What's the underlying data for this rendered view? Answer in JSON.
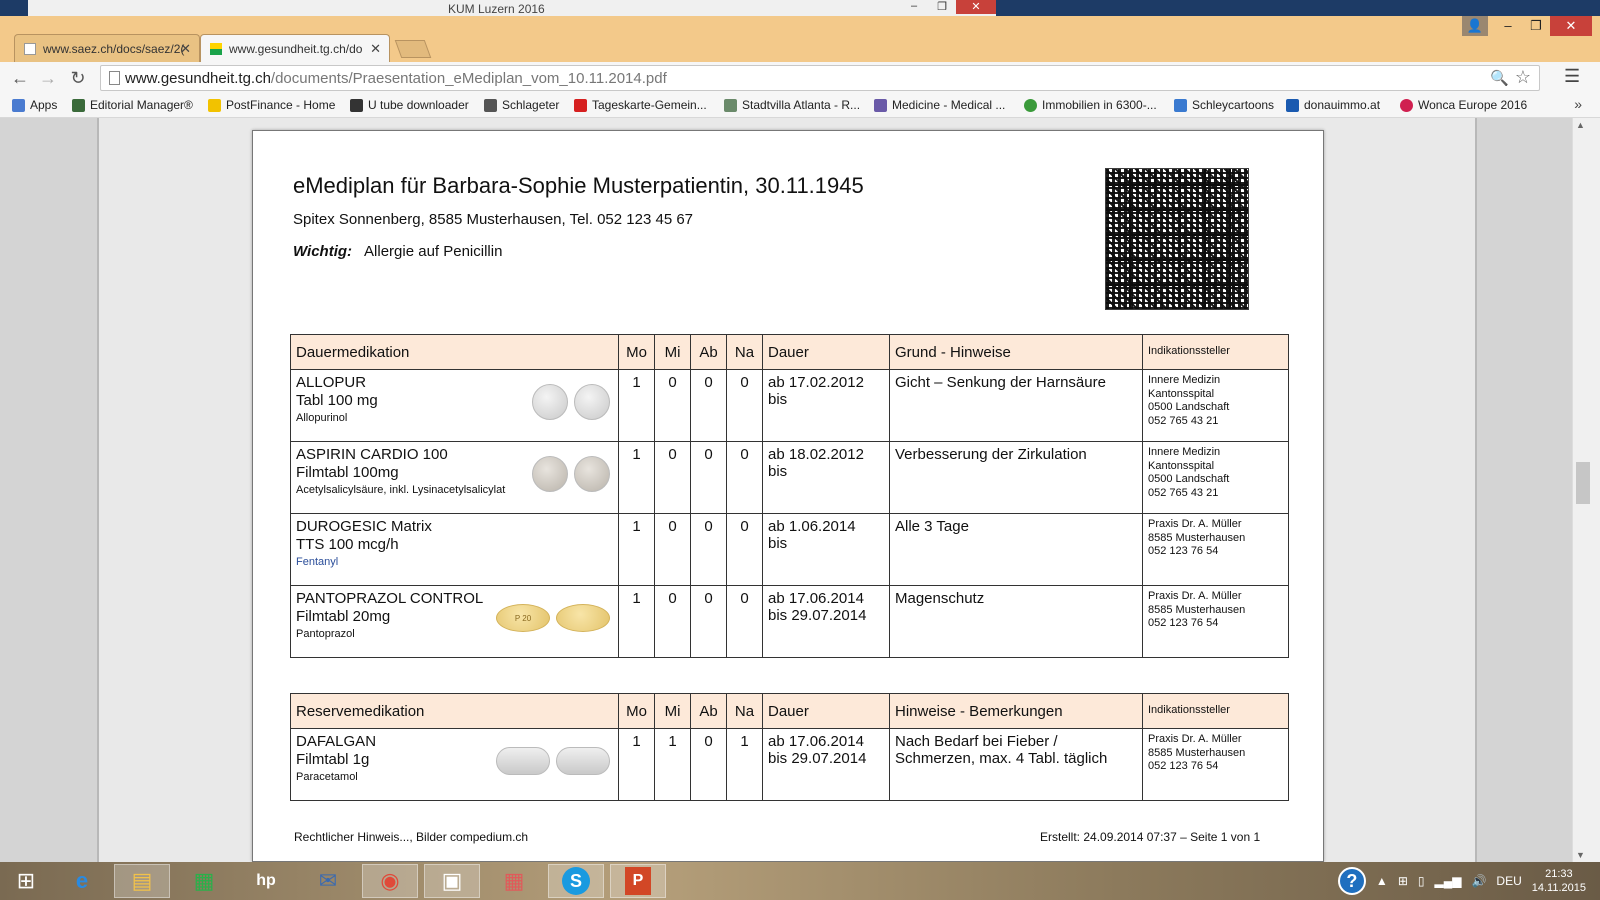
{
  "background_window": {
    "title": "KUM Luzern 2016"
  },
  "browser": {
    "tabs": [
      {
        "label": "www.saez.ch/docs/saez/2(",
        "active": false
      },
      {
        "label": "www.gesundheit.tg.ch/do",
        "active": true
      }
    ],
    "url_host": "www.gesundheit.tg.ch",
    "url_path": "/documents/Praesentation_eMediplan_vom_10.11.2014.pdf",
    "bookmarks": [
      {
        "label": "Apps",
        "icon": "apps-grid-icon",
        "color": "#4a7bd0"
      },
      {
        "label": "Editorial Manager®",
        "icon": "editorial-icon",
        "color": "#3a6a3a"
      },
      {
        "label": "PostFinance - Home",
        "icon": "postfinance-icon",
        "color": "#f2c200"
      },
      {
        "label": "U tube downloader",
        "icon": "downloader-icon",
        "color": "#333333"
      },
      {
        "label": "Schlageter",
        "icon": "schlageter-icon",
        "color": "#555555"
      },
      {
        "label": "Tageskarte-Gemein...",
        "icon": "sbb-icon",
        "color": "#d62020"
      },
      {
        "label": "Stadtvilla Atlanta - R...",
        "icon": "building-icon",
        "color": "#6a8a6a"
      },
      {
        "label": "Medicine - Medical ...",
        "icon": "medicine-icon",
        "color": "#6a5aa8"
      },
      {
        "label": "Immobilien in 6300-...",
        "icon": "check-icon",
        "color": "#3a9a3a"
      },
      {
        "label": "Schleycartoons",
        "icon": "w-icon",
        "color": "#3a7ad0"
      },
      {
        "label": "donauimmo.at",
        "icon": "d-icon",
        "color": "#1a5ab0"
      },
      {
        "label": "Wonca Europe 2016",
        "icon": "heart-icon",
        "color": "#d02050"
      }
    ],
    "bookmarks_more": "»"
  },
  "document": {
    "title": "eMediplan für Barbara-Sophie Musterpatientin, 30.11.1945",
    "subtitle": "Spitex Sonnenberg, 8585 Musterhausen, Tel. 052 123 45 67",
    "allergy_label": "Wichtig:",
    "allergy_text": "Allergie auf Penicillin",
    "dauer_table": {
      "headers": [
        "Dauermedikation",
        "Mo",
        "Mi",
        "Ab",
        "Na",
        "Dauer",
        "Grund - Hinweise",
        "Indikationssteller"
      ],
      "rows": [
        {
          "name": "ALLOPUR",
          "form": "Tabl 100 mg",
          "substance": "Allopurinol",
          "substance_blue": false,
          "mo": "1",
          "mi": "0",
          "ab": "0",
          "na": "0",
          "dauer1": "ab 17.02.2012",
          "dauer2": "bis",
          "grund": "Gicht – Senkung der Harnsäure",
          "ind": [
            "Innere Medizin",
            "Kantonsspital",
            "0500 Landschaft",
            "052 765 43 21"
          ],
          "pill": "round"
        },
        {
          "name": "ASPIRIN CARDIO 100",
          "form": "Filmtabl 100mg",
          "substance": "Acetylsalicylsäure, inkl. Lysinacetylsalicylat",
          "substance_blue": false,
          "mo": "1",
          "mi": "0",
          "ab": "0",
          "na": "0",
          "dauer1": "ab 18.02.2012",
          "dauer2": "bis",
          "grund": "Verbesserung der Zirkulation",
          "ind": [
            "Innere Medizin",
            "Kantonsspital",
            "0500 Landschaft",
            "052 765 43 21"
          ],
          "pill": "round-dark"
        },
        {
          "name": "DUROGESIC Matrix",
          "form": "TTS 100 mcg/h",
          "substance": "Fentanyl",
          "substance_blue": true,
          "mo": "1",
          "mi": "0",
          "ab": "0",
          "na": "0",
          "dauer1": "ab 1.06.2014",
          "dauer2": "bis",
          "grund": "Alle 3 Tage",
          "ind": [
            "Praxis Dr. A. Müller",
            "8585 Musterhausen",
            "052 123 76 54"
          ],
          "pill": "none"
        },
        {
          "name": "PANTOPRAZOL CONTROL",
          "form": "Filmtabl 20mg",
          "substance": "Pantoprazol",
          "substance_blue": false,
          "mo": "1",
          "mi": "0",
          "ab": "0",
          "na": "0",
          "dauer1": "ab 17.06.2014",
          "dauer2": "bis 29.07.2014",
          "grund": "Magenschutz",
          "ind": [
            "Praxis Dr. A. Müller",
            "8585 Musterhausen",
            "052 123 76 54"
          ],
          "pill": "yellow",
          "pill_imprint": "P 20"
        }
      ]
    },
    "reserve_table": {
      "headers": [
        "Reservemedikation",
        "Mo",
        "Mi",
        "Ab",
        "Na",
        "Dauer",
        "Hinweise - Bemerkungen",
        "Indikationssteller"
      ],
      "rows": [
        {
          "name": "DAFALGAN",
          "form": "Filmtabl 1g",
          "substance": "Paracetamol",
          "substance_blue": false,
          "mo": "1",
          "mi": "1",
          "ab": "0",
          "na": "1",
          "dauer1": "ab 17.06.2014",
          "dauer2": "bis 29.07.2014",
          "grund": "Nach Bedarf bei Fieber /",
          "grund2": "Schmerzen, max. 4 Tabl. täglich",
          "ind": [
            "Praxis Dr. A. Müller",
            "8585 Musterhausen",
            "052 123 76 54"
          ],
          "pill": "oblong"
        }
      ]
    },
    "footer_left": "Rechtlicher Hinweis..., Bilder compedium.ch",
    "footer_right": "Erstellt: 24.09.2014 07:37 – Seite 1 von 1"
  },
  "taskbar": {
    "apps": [
      "start-icon",
      "internet-explorer-icon",
      "file-explorer-icon",
      "store-icon",
      "hp-icon",
      "thunderbird-icon",
      "chrome-icon",
      "app-icon",
      "apps-icon",
      "skype-icon",
      "powerpoint-icon"
    ],
    "language": "DEU",
    "time": "21:33",
    "date": "14.11.2015"
  }
}
